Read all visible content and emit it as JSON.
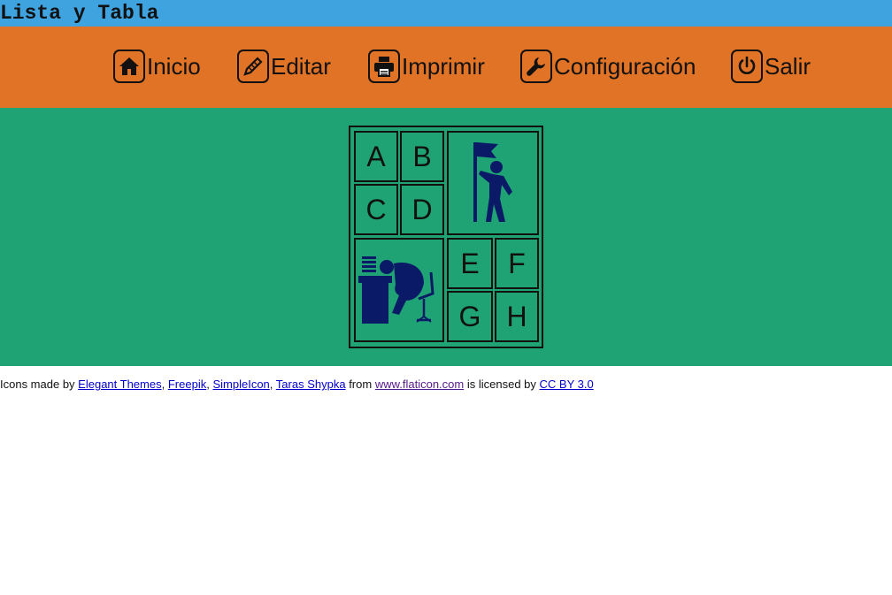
{
  "header": {
    "title": "Lista y Tabla"
  },
  "nav": {
    "items": [
      {
        "label": "Inicio",
        "icon": "home-icon"
      },
      {
        "label": "Editar",
        "icon": "pencil-icon"
      },
      {
        "label": "Imprimir",
        "icon": "printer-icon"
      },
      {
        "label": "Configuración",
        "icon": "wrench-icon"
      },
      {
        "label": "Salir",
        "icon": "power-icon"
      }
    ]
  },
  "table": {
    "cells": [
      "A",
      "B",
      "C",
      "D",
      "E",
      "F",
      "G",
      "H"
    ],
    "images": [
      "person-with-flag-icon",
      "tired-person-at-desk-icon"
    ]
  },
  "footer": {
    "prefix": "Icons made by",
    "authors": [
      "Elegant Themes",
      "Freepik",
      "SimpleIcon",
      "Taras Shypka"
    ],
    "sep": ",",
    "from": "from",
    "site": "www.flaticon.com",
    "licensed": "is licensed by",
    "license": "CC BY 3.0"
  },
  "colors": {
    "titlebar": "#3fa3e0",
    "navbar": "#e07326",
    "main": "#1fa374",
    "icon_fill": "#0b1a66"
  }
}
